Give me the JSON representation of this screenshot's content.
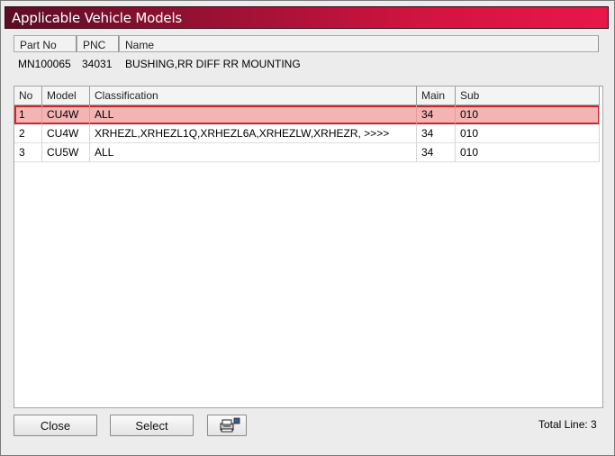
{
  "window": {
    "title": "Applicable Vehicle Models"
  },
  "part": {
    "headers": {
      "part_no": "Part No",
      "pnc": "PNC",
      "name": "Name"
    },
    "values": {
      "part_no": "MN100065",
      "pnc": "34031",
      "name": "BUSHING,RR DIFF RR MOUNTING"
    }
  },
  "table": {
    "columns": {
      "no": "No",
      "model": "Model",
      "classification": "Classification",
      "main": "Main",
      "sub": "Sub"
    },
    "rows": [
      {
        "no": "1",
        "model": "CU4W",
        "classification": "ALL",
        "main": "34",
        "sub": "010"
      },
      {
        "no": "2",
        "model": "CU4W",
        "classification": "XRHEZL,XRHEZL1Q,XRHEZL6A,XRHEZLW,XRHEZR,  >>>>",
        "main": "34",
        "sub": "010"
      },
      {
        "no": "3",
        "model": "CU5W",
        "classification": "ALL",
        "main": "34",
        "sub": "010"
      }
    ],
    "selected_row": 1
  },
  "footer": {
    "close_label": "Close",
    "select_label": "Select",
    "print_icon": "printer-icon",
    "total_line": "Total Line: 3"
  },
  "colors": {
    "title_gradient_end": "#e8174a",
    "selected_row_bg": "#f4b4b4",
    "selected_row_border": "#c8282f"
  }
}
